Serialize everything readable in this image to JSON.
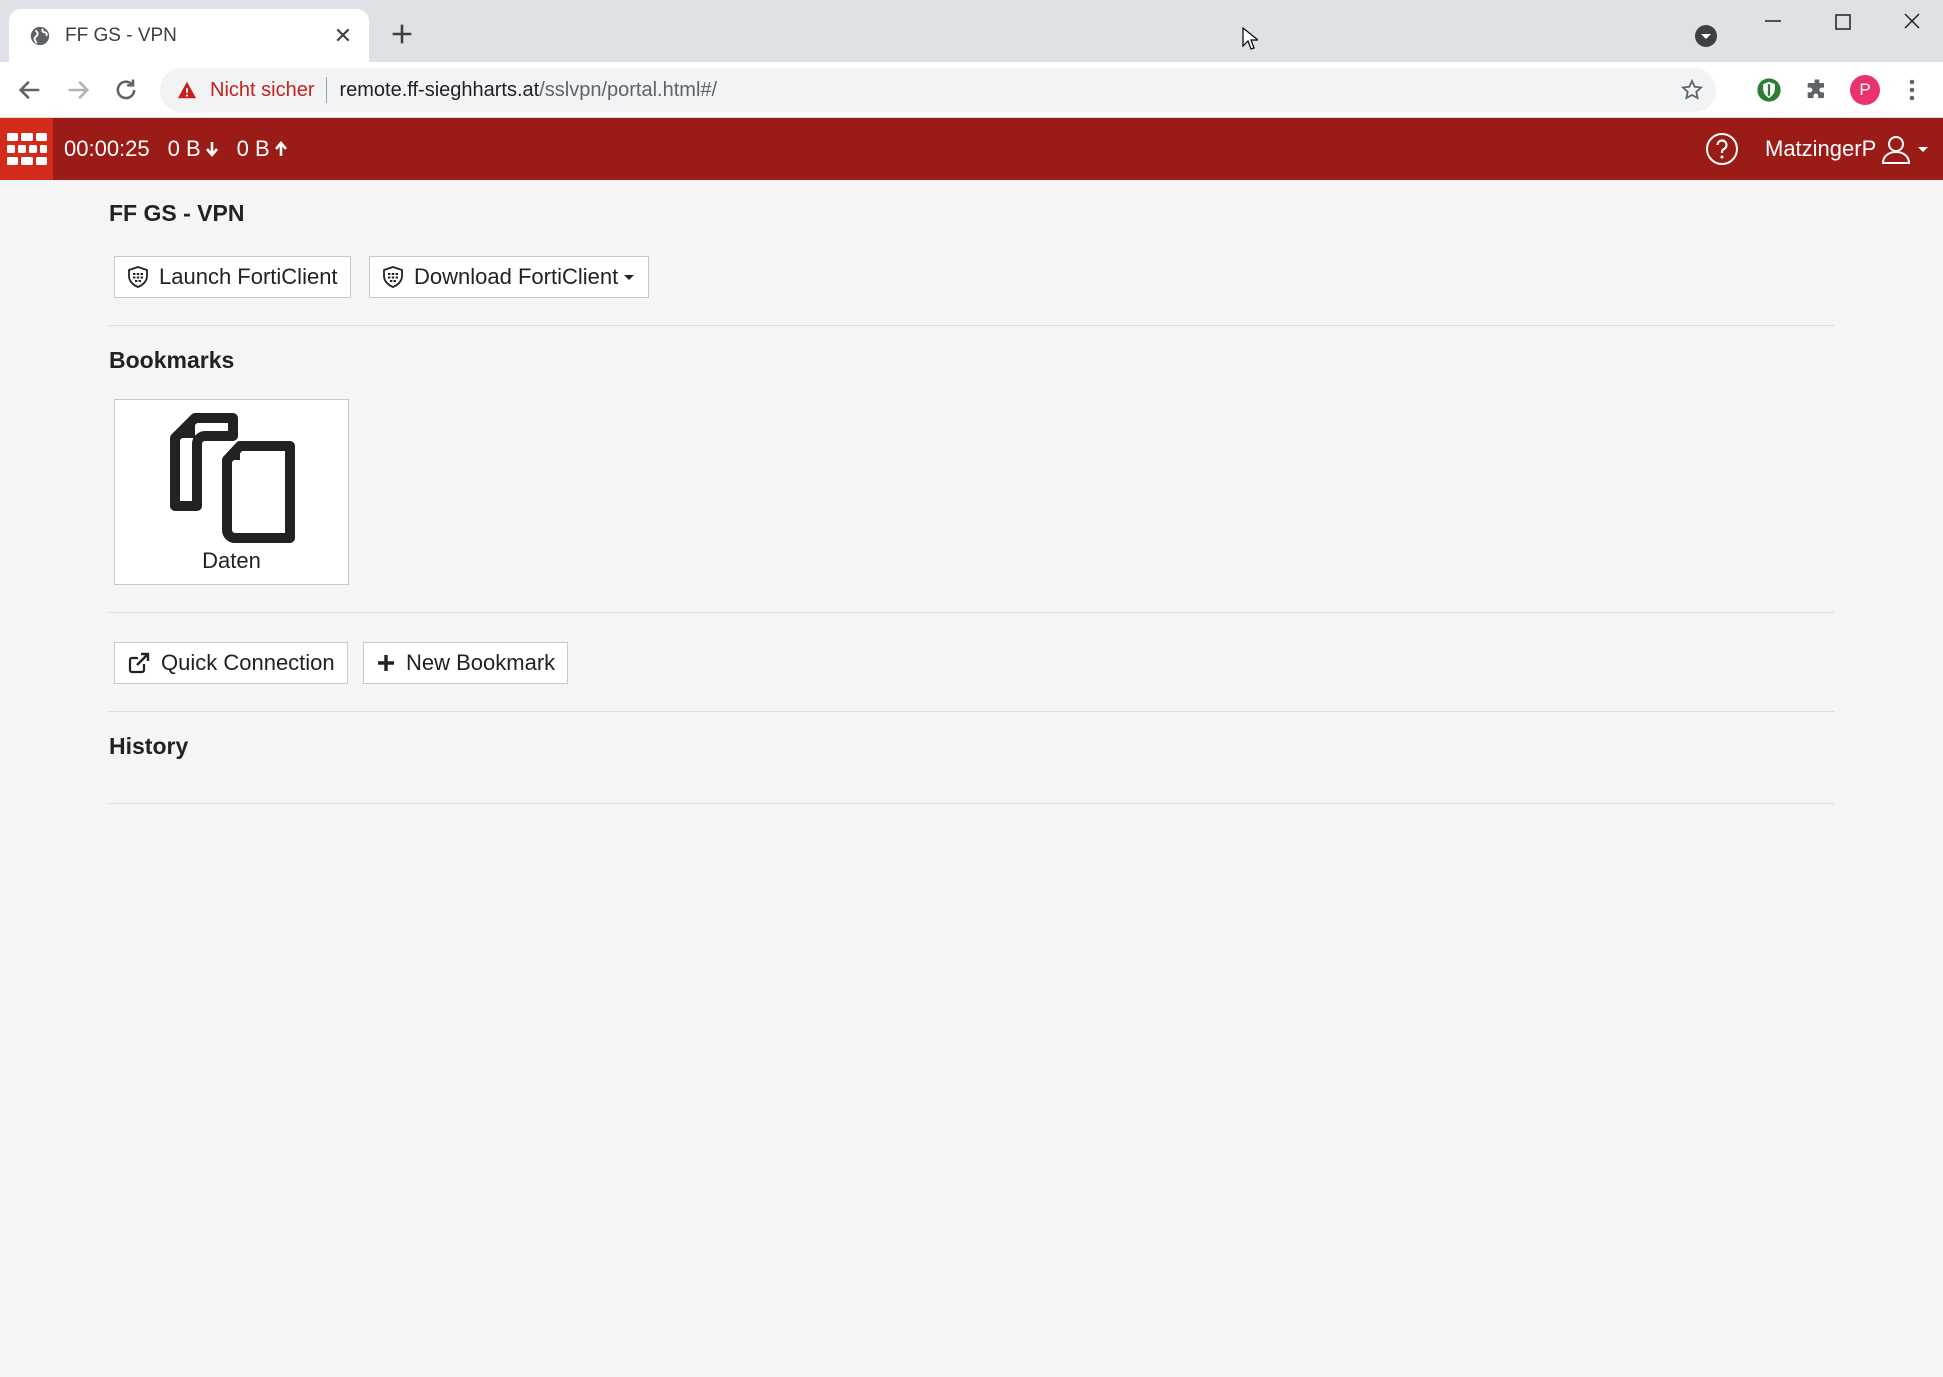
{
  "browser": {
    "tab_title": "FF GS - VPN",
    "security_label": "Nicht sicher",
    "url_host": "remote.ff-sieghharts.at",
    "url_path": "/sslvpn/portal.html#/",
    "profile_initial": "P"
  },
  "header": {
    "timer": "00:00:25",
    "download": "0 B",
    "upload": "0 B",
    "username": "MatzingerP"
  },
  "portal": {
    "title": "FF GS - VPN",
    "launch_label": "Launch FortiClient",
    "download_label": "Download FortiClient"
  },
  "bookmarks": {
    "title": "Bookmarks",
    "items": [
      {
        "label": "Daten"
      }
    ]
  },
  "actions": {
    "quick_connection": "Quick Connection",
    "new_bookmark": "New Bookmark"
  },
  "history": {
    "title": "History"
  },
  "colors": {
    "header_bg": "#9b1c17",
    "logo_bg": "#d42a1c",
    "page_bg": "#f5f5f5"
  }
}
